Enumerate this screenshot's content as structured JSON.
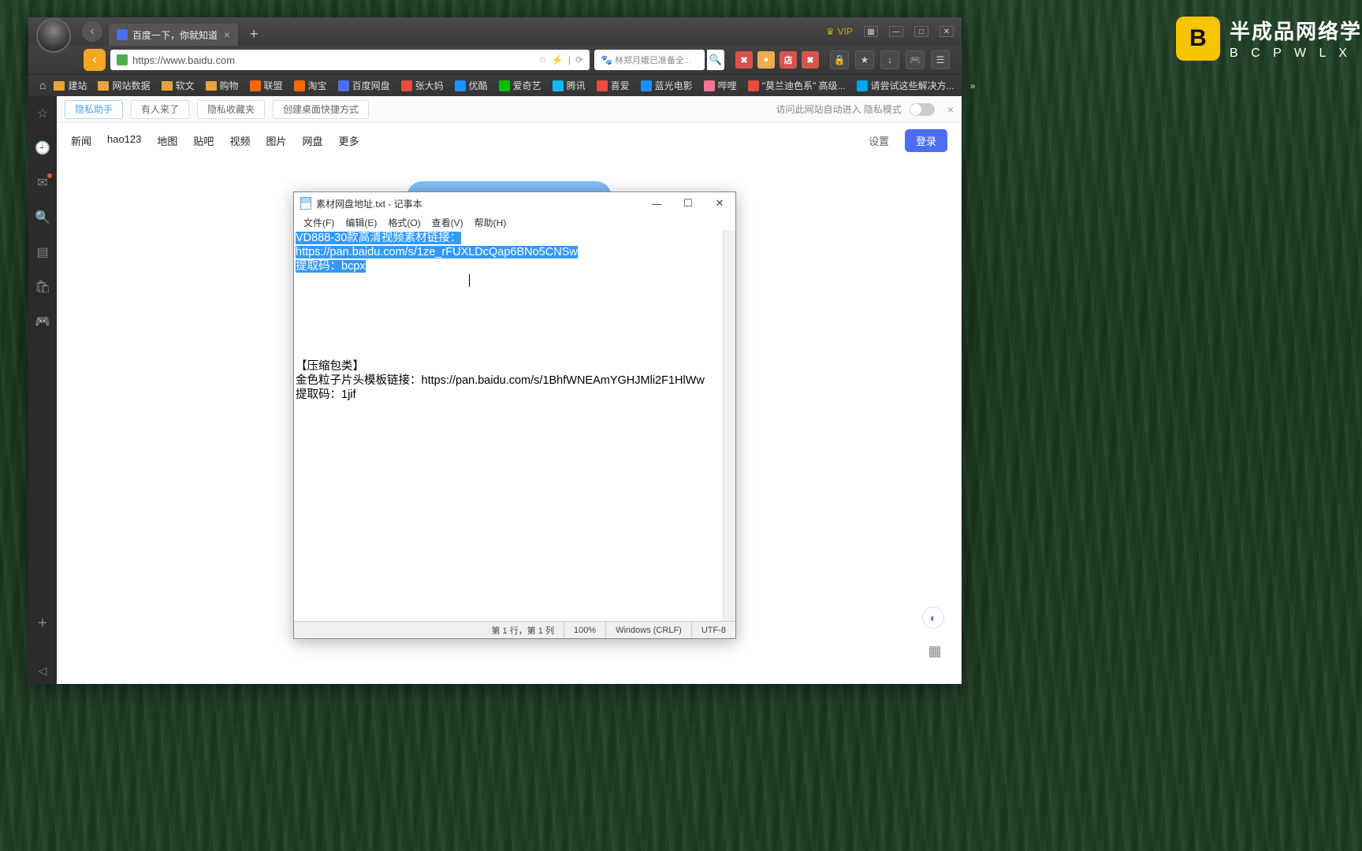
{
  "watermark": {
    "logo": "B",
    "main": "半成品网络学",
    "sub": "B C P W L X"
  },
  "titlebar": {
    "tab_title": "百度一下，你就知道",
    "vip": "VIP"
  },
  "addressbar": {
    "url": "https://www.baidu.com",
    "search_placeholder": "林郑月娥已准备全...",
    "ext_colors": [
      "#d9534f",
      "#f0ad4e",
      "#d9534f",
      "#d9534f"
    ]
  },
  "bookmarks": [
    {
      "type": "folder",
      "label": "建站"
    },
    {
      "type": "folder",
      "label": "网站数据"
    },
    {
      "type": "folder",
      "label": "软文"
    },
    {
      "type": "folder",
      "label": "购物"
    },
    {
      "type": "ico",
      "label": "联盟",
      "color": "#f60"
    },
    {
      "type": "ico",
      "label": "淘宝",
      "color": "#f60"
    },
    {
      "type": "ico",
      "label": "百度网盘",
      "color": "#4e6ef2"
    },
    {
      "type": "ico",
      "label": "张大妈",
      "color": "#e74c3c"
    },
    {
      "type": "ico",
      "label": "优酷",
      "color": "#1e90ff"
    },
    {
      "type": "ico",
      "label": "爱奇艺",
      "color": "#00be06"
    },
    {
      "type": "ico",
      "label": "腾讯",
      "color": "#12b7f5"
    },
    {
      "type": "ico",
      "label": "喜爱",
      "color": "#e74c3c"
    },
    {
      "type": "ico",
      "label": "蓝光电影",
      "color": "#1e90ff"
    },
    {
      "type": "ico",
      "label": "哔哩",
      "color": "#fb7299"
    },
    {
      "type": "ico",
      "label": "\"莫兰迪色系\" 高级...",
      "color": "#e74c3c"
    },
    {
      "type": "ico",
      "label": "请尝试这些解决方...",
      "color": "#00a4ef"
    }
  ],
  "noticebar": {
    "privacy": "隐私助手",
    "visitors": "有人来了",
    "fav": "隐私收藏夹",
    "shortcut": "创建桌面快捷方式",
    "auto_text": "访问此网站自动进入 隐私模式"
  },
  "baidu": {
    "nav": [
      "新闻",
      "hao123",
      "地图",
      "贴吧",
      "视频",
      "图片",
      "网盘",
      "更多"
    ],
    "settings": "设置",
    "login": "登录"
  },
  "notepad": {
    "title": "素材网盘地址.txt - 记事本",
    "menu": [
      "文件(F)",
      "编辑(E)",
      "格式(O)",
      "查看(V)",
      "帮助(H)"
    ],
    "sel_line1": "VD888-30款高清视频素材链接：https://pan.baidu.com/s/1ze_rFUXLDcQap6BNo5CNSw",
    "sel_line2": "提取码：bcpx",
    "body_line3": "【压缩包类】",
    "body_line4": "金色粒子片头模板链接：https://pan.baidu.com/s/1BhfWNEAmYGHJMli2F1HlWw",
    "body_line5": "提取码：1jif",
    "status": {
      "pos": "第 1 行，第 1 列",
      "zoom": "100%",
      "eol": "Windows (CRLF)",
      "enc": "UTF-8"
    }
  }
}
